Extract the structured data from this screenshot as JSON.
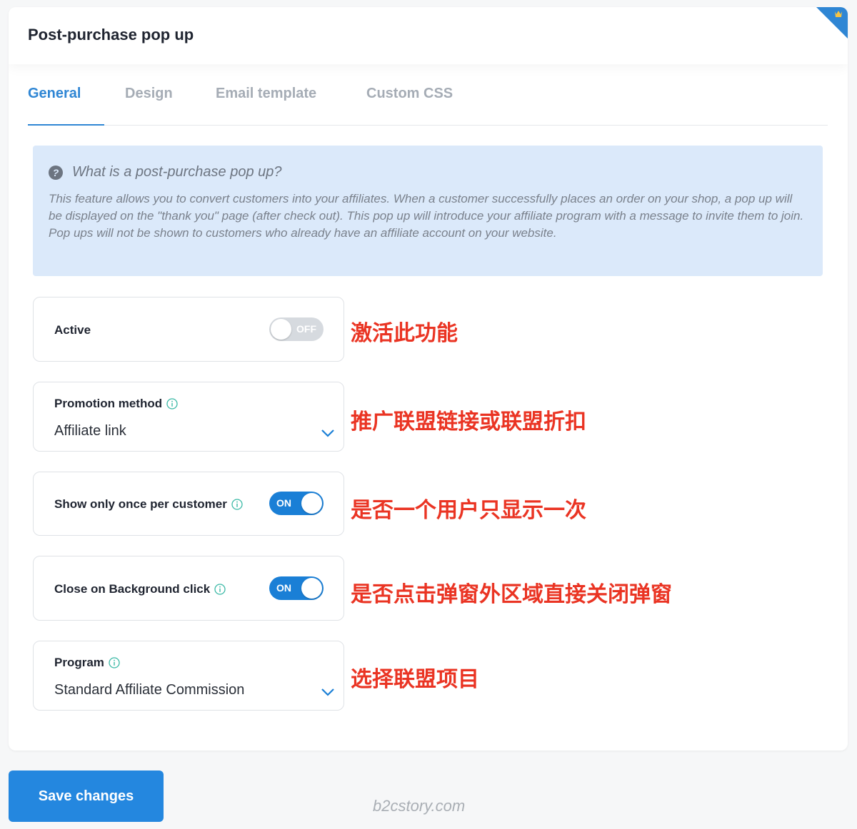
{
  "header": {
    "title": "Post-purchase pop up"
  },
  "tabs": [
    {
      "label": "General",
      "active": true
    },
    {
      "label": "Design",
      "active": false
    },
    {
      "label": "Email template",
      "active": false
    },
    {
      "label": "Custom CSS",
      "active": false
    }
  ],
  "info": {
    "title": "What is a post-purchase pop up?",
    "description": "This feature allows you to convert customers into your affiliates. When a customer successfully places an order on your shop, a pop up will be displayed on the \"thank you\" page (after check out). This pop up will introduce your affiliate program with a message to invite them to join. Pop ups will not be shown to customers who already have an affiliate account on your website."
  },
  "settings": {
    "active": {
      "label": "Active",
      "state": "OFF",
      "note": "激活此功能"
    },
    "promotion_method": {
      "label": "Promotion method",
      "value": "Affiliate link",
      "note": "推广联盟链接或联盟折扣"
    },
    "show_once": {
      "label": "Show only once per customer",
      "state": "ON",
      "note": "是否一个用户只显示一次"
    },
    "close_bg": {
      "label": "Close on Background click",
      "state": "ON",
      "note": "是否点击弹窗外区域直接关闭弹窗"
    },
    "program": {
      "label": "Program",
      "value": "Standard Affiliate Commission",
      "note": "选择联盟项目"
    }
  },
  "footer": {
    "save_label": "Save changes",
    "watermark": "b2cstory.com"
  },
  "colors": {
    "accent": "#2f86d4",
    "toggle_on": "#1a7fd6",
    "annotation": "#ea3423",
    "info_bg": "#dbe9fa"
  },
  "icons": {
    "corner": "crown-icon",
    "info": "question-circle-icon",
    "tooltip": "info-circle-icon",
    "dropdown": "chevron-down-icon"
  }
}
